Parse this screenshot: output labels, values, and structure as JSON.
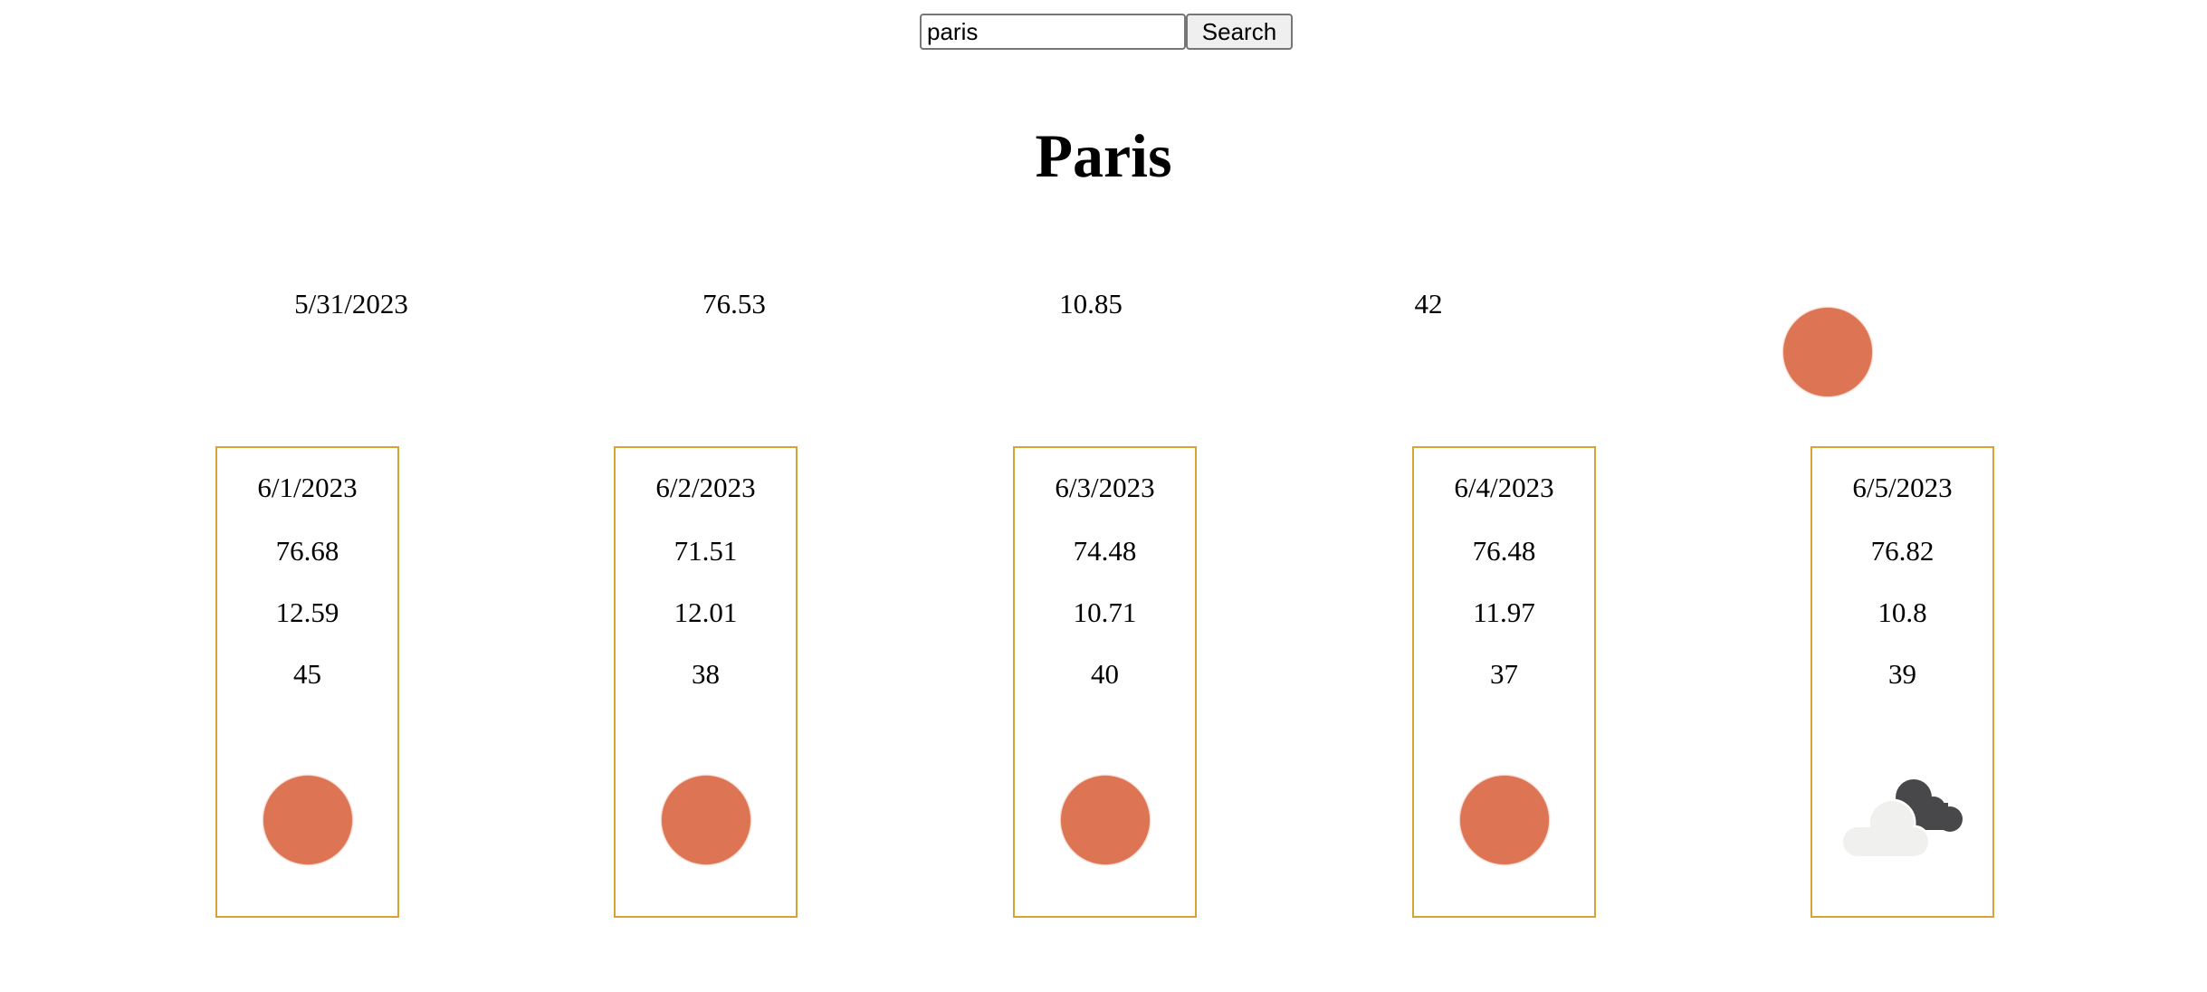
{
  "search": {
    "value": "paris",
    "button_label": "Search"
  },
  "city": "Paris",
  "current": {
    "date": "5/31/2023",
    "temp": "76.53",
    "wind": "10.85",
    "humidity": "42",
    "icon": "sun-icon"
  },
  "forecast": [
    {
      "date": "6/1/2023",
      "temp": "76.68",
      "wind": "12.59",
      "humidity": "45",
      "icon": "sun-icon"
    },
    {
      "date": "6/2/2023",
      "temp": "71.51",
      "wind": "12.01",
      "humidity": "38",
      "icon": "sun-icon"
    },
    {
      "date": "6/3/2023",
      "temp": "74.48",
      "wind": "10.71",
      "humidity": "40",
      "icon": "sun-icon"
    },
    {
      "date": "6/4/2023",
      "temp": "76.48",
      "wind": "11.97",
      "humidity": "37",
      "icon": "sun-icon"
    },
    {
      "date": "6/5/2023",
      "temp": "76.82",
      "wind": "10.8",
      "humidity": "39",
      "icon": "cloud-icon"
    }
  ],
  "colors": {
    "sun": "#dd7555",
    "card_border": "#d9a235"
  }
}
